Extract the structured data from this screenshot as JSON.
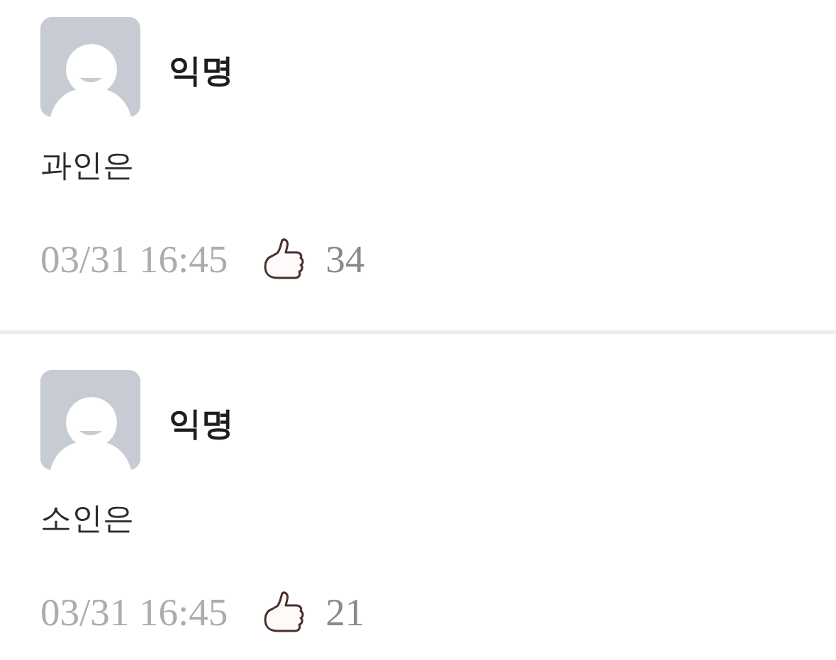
{
  "comments": [
    {
      "author": "익명",
      "text": "과인은",
      "time": "03/31 16:45",
      "likes": "34"
    },
    {
      "author": "익명",
      "text": "소인은",
      "time": "03/31 16:45",
      "likes": "21"
    }
  ]
}
